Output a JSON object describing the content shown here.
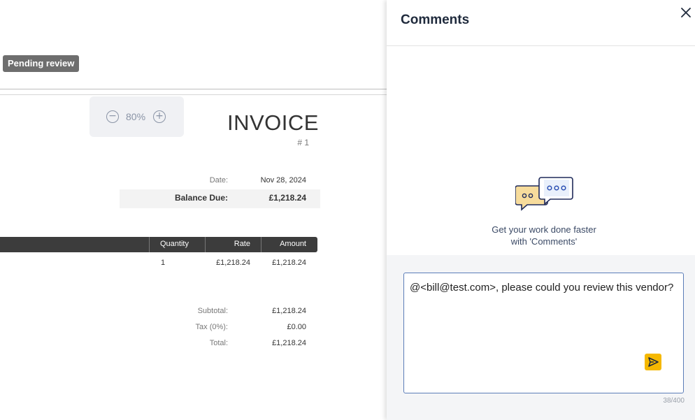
{
  "invoice": {
    "status_badge": "Pending review",
    "zoom": {
      "level": "80%",
      "minus_glyph": "−",
      "plus_glyph": "+"
    },
    "title": "INVOICE",
    "number": "# 1",
    "date_label": "Date:",
    "date_value": "Nov 28, 2024",
    "balance_label": "Balance Due:",
    "balance_value": "£1,218.24",
    "table": {
      "headers": [
        "Quantity",
        "Rate",
        "Amount"
      ],
      "rows": [
        {
          "quantity": "1",
          "rate": "£1,218.24",
          "amount": "£1,218.24"
        }
      ]
    },
    "totals": {
      "subtotal_label": "Subtotal:",
      "subtotal_value": "£1,218.24",
      "tax_label": "Tax (0%):",
      "tax_value": "£0.00",
      "total_label": "Total:",
      "total_value": "£1,218.24"
    }
  },
  "comments": {
    "title": "Comments",
    "close_icon": "close-icon",
    "empty_line1": "Get your work done faster",
    "empty_line2": "with 'Comments'",
    "input_value": "@<bill@test.com>, please could you review this vendor?",
    "char_counter": "38/400",
    "send_icon": "send-icon"
  }
}
